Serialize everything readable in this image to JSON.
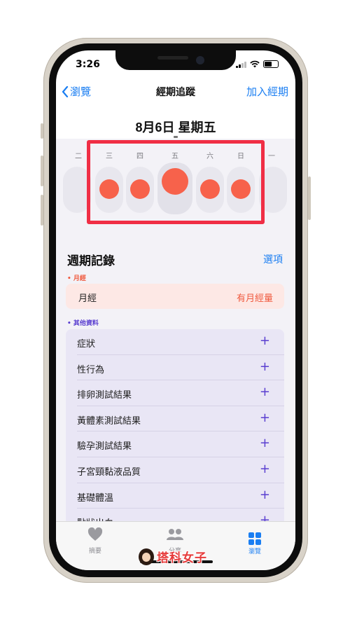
{
  "status": {
    "time": "3:26"
  },
  "nav": {
    "back_label": "瀏覽",
    "title": "經期追蹤",
    "add_label": "加入經期"
  },
  "date_title": "8月6日 星期五",
  "days": [
    {
      "label": "二",
      "has_flow": false
    },
    {
      "label": "三",
      "has_flow": true
    },
    {
      "label": "四",
      "has_flow": true
    },
    {
      "label": "五",
      "has_flow": true,
      "today": true
    },
    {
      "label": "六",
      "has_flow": true
    },
    {
      "label": "日",
      "has_flow": true
    },
    {
      "label": "一",
      "has_flow": false
    }
  ],
  "cycle_log": {
    "title": "週期記錄",
    "options_label": "選項",
    "period_section_label": "• 月經",
    "period_row_label": "月經",
    "period_row_value": "有月經量",
    "other_section_label": "• 其他資料",
    "other_items": [
      "症狀",
      "性行為",
      "排卵測試結果",
      "黃體素測試結果",
      "驗孕測試結果",
      "子宮頸黏液品質",
      "基礎體溫",
      "點狀出血"
    ],
    "add_glyph": "+"
  },
  "tabbar": {
    "tabs": [
      {
        "label": "摘要",
        "icon": "heart-icon",
        "active": false
      },
      {
        "label": "分享",
        "icon": "people-icon",
        "active": false
      },
      {
        "label": "瀏覽",
        "icon": "grid-icon",
        "active": true
      }
    ]
  },
  "watermark": {
    "text": "塔科女子"
  },
  "colors": {
    "accent": "#1a7ef2",
    "flow_dot": "#f7624b",
    "highlight": "#f02e45",
    "period_bg": "#fde8e5",
    "period_value": "#f05a3f",
    "other_bg": "#e9e6f5",
    "other_plus": "#5a3fd0"
  }
}
